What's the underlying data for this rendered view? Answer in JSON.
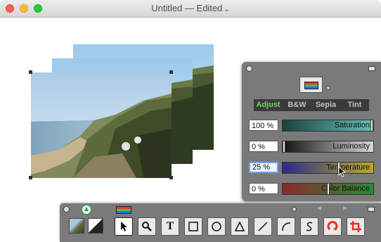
{
  "window": {
    "title": "Untitled — Edited",
    "title_chevron": "⌄"
  },
  "color_panel": {
    "tabs": [
      {
        "label": "Adjust",
        "active": true
      },
      {
        "label": "B&W",
        "active": false
      },
      {
        "label": "Sepia",
        "active": false
      },
      {
        "label": "Tint",
        "active": false
      }
    ],
    "sliders": [
      {
        "name": "saturation",
        "value": "100 %",
        "label": "Saturation",
        "level": 1.0,
        "gradient": [
          "#1d3f3c",
          "#62c2b8"
        ]
      },
      {
        "name": "luminosity",
        "value": "0 %",
        "label": "Luminosity",
        "level": 0.0,
        "gradient": [
          "#111111",
          "#d8d8d8"
        ]
      },
      {
        "name": "temperature",
        "value": "25 %",
        "label": "Temperature",
        "level": 0.62,
        "gradient": [
          "#2a2a8a",
          "#b8a92a"
        ]
      },
      {
        "name": "color_balance",
        "value": "0 %",
        "label": "Color Balance",
        "level": 0.5,
        "gradient": [
          "#8a2a2a",
          "#2a8a3a"
        ]
      }
    ]
  },
  "tools_bar": {
    "tools": [
      {
        "name": "pointer",
        "selected": true
      },
      {
        "name": "magnifier",
        "selected": false
      },
      {
        "name": "text",
        "label": "T",
        "selected": false
      },
      {
        "name": "rectangle",
        "selected": false
      },
      {
        "name": "ellipse",
        "selected": false
      },
      {
        "name": "triangle",
        "selected": false
      },
      {
        "name": "line",
        "selected": false
      },
      {
        "name": "arc",
        "selected": false
      },
      {
        "name": "freehand",
        "selected": false
      },
      {
        "name": "rotate",
        "selected": false
      },
      {
        "name": "crop",
        "selected": false
      }
    ],
    "nav_prev": "◀",
    "nav_next": "▶"
  },
  "colors": {
    "panel_bg": "#7a7a7a",
    "active_tab": "#6fd86a",
    "focus_ring": "#6fa1e9",
    "tool_icon_red": "#e0322a"
  }
}
